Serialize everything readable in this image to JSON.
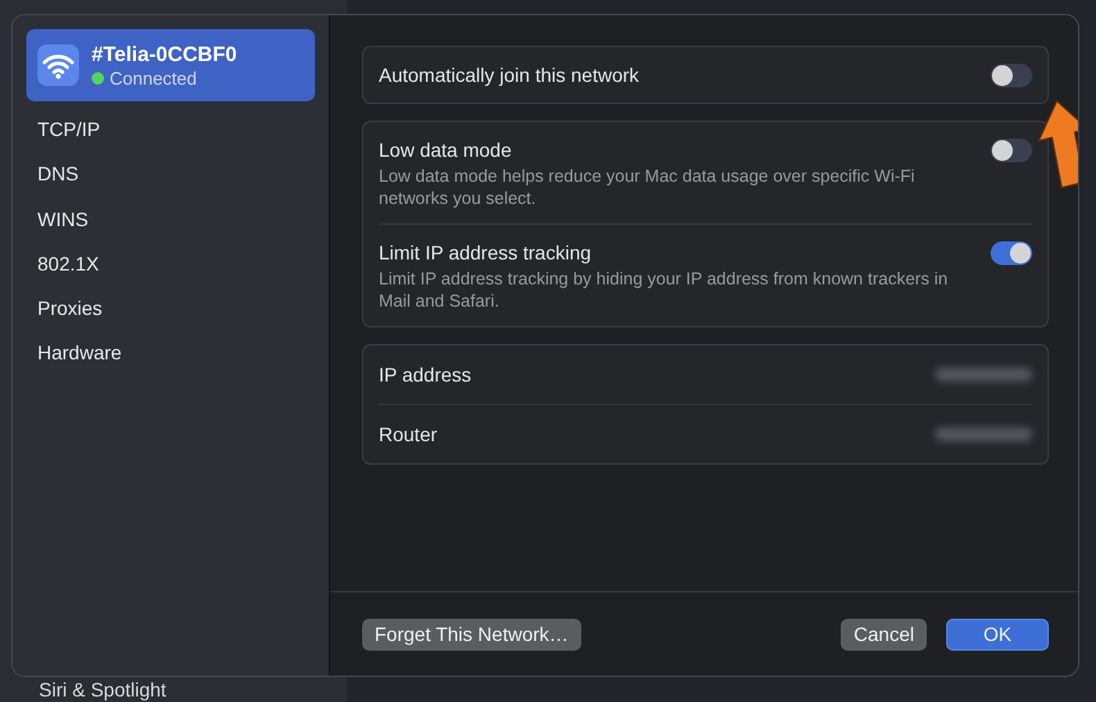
{
  "background": {
    "sidebar_item": "Siri & Spotlight"
  },
  "network": {
    "name": "#Telia-0CCBF0",
    "status": "Connected",
    "connected": true,
    "selected": true
  },
  "sidebar": {
    "items": [
      {
        "label": "TCP/IP",
        "selected": false
      },
      {
        "label": "DNS",
        "selected": false
      },
      {
        "label": "WINS",
        "selected": false
      },
      {
        "label": "802.1X",
        "selected": false
      },
      {
        "label": "Proxies",
        "selected": false
      },
      {
        "label": "Hardware",
        "selected": false
      }
    ]
  },
  "cards": [
    {
      "kind": "toggles",
      "items": [
        {
          "label": "Automatically join this network",
          "on": false
        }
      ]
    },
    {
      "kind": "toggles",
      "items": [
        {
          "label": "Low data mode",
          "description": "Low data mode helps reduce your Mac data usage over specific Wi-Fi networks you select.",
          "on": false
        },
        {
          "label": "Limit IP address tracking",
          "description": "Limit IP address tracking by hiding your IP address from known trackers in Mail and Safari.",
          "on": true
        }
      ]
    },
    {
      "kind": "info",
      "items": [
        {
          "label": "IP address"
        },
        {
          "label": "Router"
        }
      ]
    }
  ],
  "footer": {
    "buttons": [
      {
        "label": "Forget This Network…",
        "kind": "secondary",
        "default": false
      },
      {
        "label": "Cancel",
        "kind": "secondary",
        "default": false
      },
      {
        "label": "OK",
        "kind": "primary",
        "default": true
      }
    ]
  },
  "annotation": {
    "kind": "arrow"
  }
}
